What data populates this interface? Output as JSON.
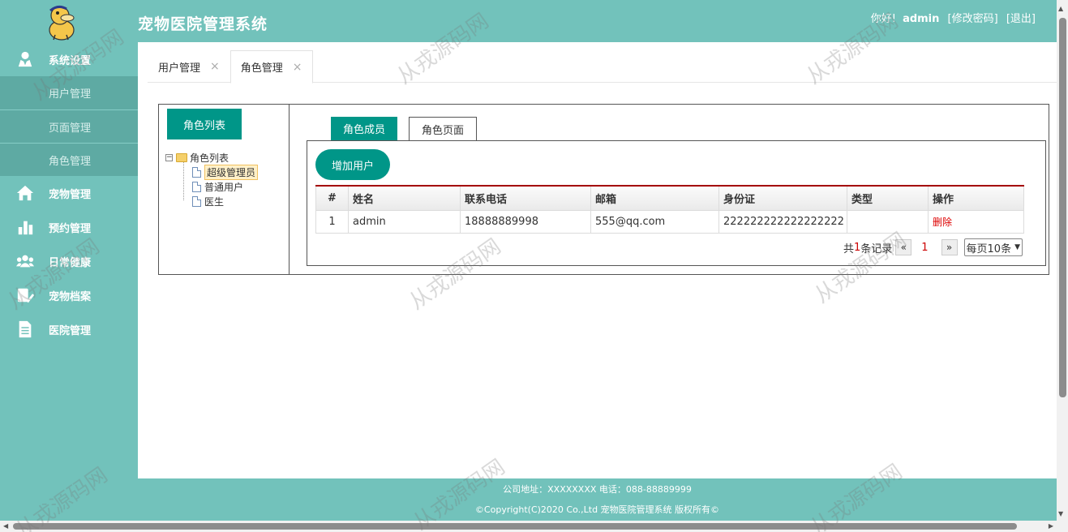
{
  "app": {
    "title": "宠物医院管理系统",
    "greeting": "你好!",
    "username": "admin",
    "change_password": "[修改密码]",
    "logout": "[退出]"
  },
  "sidebar": {
    "sections": [
      {
        "label": "系统设置",
        "icon": "user-settings-icon"
      },
      {
        "label": "宠物管理",
        "icon": "home-icon"
      },
      {
        "label": "预约管理",
        "icon": "bar-chart-icon"
      },
      {
        "label": "日常健康",
        "icon": "group-icon"
      },
      {
        "label": "宠物档案",
        "icon": "pet-record-icon"
      },
      {
        "label": "医院管理",
        "icon": "document-icon"
      }
    ],
    "sub_items": [
      "用户管理",
      "页面管理",
      "角色管理"
    ]
  },
  "tabs": [
    {
      "label": "用户管理",
      "close": "×"
    },
    {
      "label": "角色管理",
      "close": "×"
    }
  ],
  "role_panel": {
    "button": "角色列表",
    "tree": {
      "root": "角色列表",
      "toggle": "−",
      "children": [
        "超级管理员",
        "普通用户",
        "医生"
      ]
    }
  },
  "detail_panel": {
    "tabs": [
      "角色成员",
      "角色页面"
    ],
    "add_button": "增加用户",
    "table": {
      "headers": [
        "#",
        "姓名",
        "联系电话",
        "邮箱",
        "身份证",
        "类型",
        "操作"
      ],
      "rows": [
        [
          "1",
          "admin",
          "18888889998",
          "555@qq.com",
          "222222222222222222",
          "",
          "删除"
        ]
      ]
    },
    "pager": {
      "total_prefix": "共",
      "total": "1",
      "total_suffix": "条记录",
      "prev": "«",
      "page": "1",
      "next": "»",
      "page_size": "每页10条"
    }
  },
  "footer": {
    "line1": "公司地址：XXXXXXXX 电话：088-88889999",
    "line2": "©Copyright(C)2020 Co.,Ltd 宠物医院管理系统 版权所有©"
  },
  "watermark": "从戎源码网",
  "colors": {
    "primary": "#72c2bb",
    "sub_bg": "#5eaaa3",
    "button": "#009688",
    "table_accent": "#a40000",
    "danger": "#dd0000"
  }
}
